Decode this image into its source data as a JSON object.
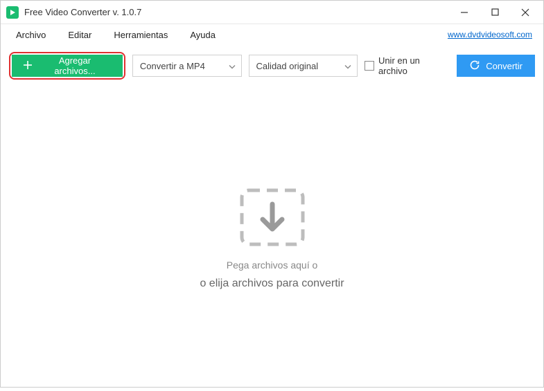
{
  "titlebar": {
    "title": "Free Video Converter v. 1.0.7"
  },
  "menubar": {
    "items": [
      "Archivo",
      "Editar",
      "Herramientas",
      "Ayuda"
    ],
    "link": "www.dvdvideosoft.com"
  },
  "toolbar": {
    "add_label": "Agregar archivos...",
    "format_selected": "Convertir a MP4",
    "quality_selected": "Calidad original",
    "merge_label": "Unir en un archivo",
    "convert_label": "Convertir"
  },
  "dropzone": {
    "line1": "Pega archivos aquí o",
    "line2": "o elija archivos para convertir"
  }
}
